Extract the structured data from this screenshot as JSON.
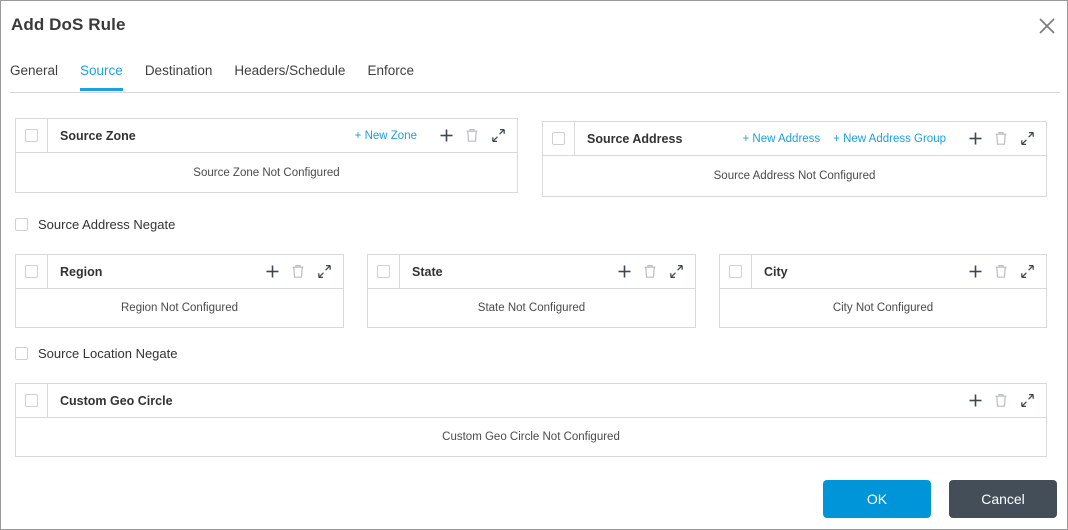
{
  "dialog": {
    "title": "Add DoS Rule",
    "close_icon": "close-icon"
  },
  "tabs": [
    {
      "label": "General",
      "active": false
    },
    {
      "label": "Source",
      "active": true
    },
    {
      "label": "Destination",
      "active": false
    },
    {
      "label": "Headers/Schedule",
      "active": false
    },
    {
      "label": "Enforce",
      "active": false
    }
  ],
  "panels": {
    "source_zone": {
      "title": "Source Zone",
      "empty_text": "Source Zone Not Configured",
      "links": [
        "+ New Zone"
      ]
    },
    "source_address": {
      "title": "Source Address",
      "empty_text": "Source Address Not Configured",
      "links": [
        "+ New Address",
        "+ New Address Group"
      ]
    },
    "region": {
      "title": "Region",
      "empty_text": "Region Not Configured",
      "links": []
    },
    "state": {
      "title": "State",
      "empty_text": "State Not Configured",
      "links": []
    },
    "city": {
      "title": "City",
      "empty_text": "City Not Configured",
      "links": []
    },
    "custom_geo_circle": {
      "title": "Custom Geo Circle",
      "empty_text": "Custom Geo Circle Not Configured",
      "links": []
    }
  },
  "negates": {
    "source_address_negate": "Source Address Negate",
    "source_location_negate": "Source Location Negate"
  },
  "footer": {
    "ok_label": "OK",
    "cancel_label": "Cancel"
  },
  "colors": {
    "accent": "#1ba1e2",
    "ok_button": "#0095d9",
    "cancel_button": "#434e58",
    "border": "#d9d9d9"
  }
}
